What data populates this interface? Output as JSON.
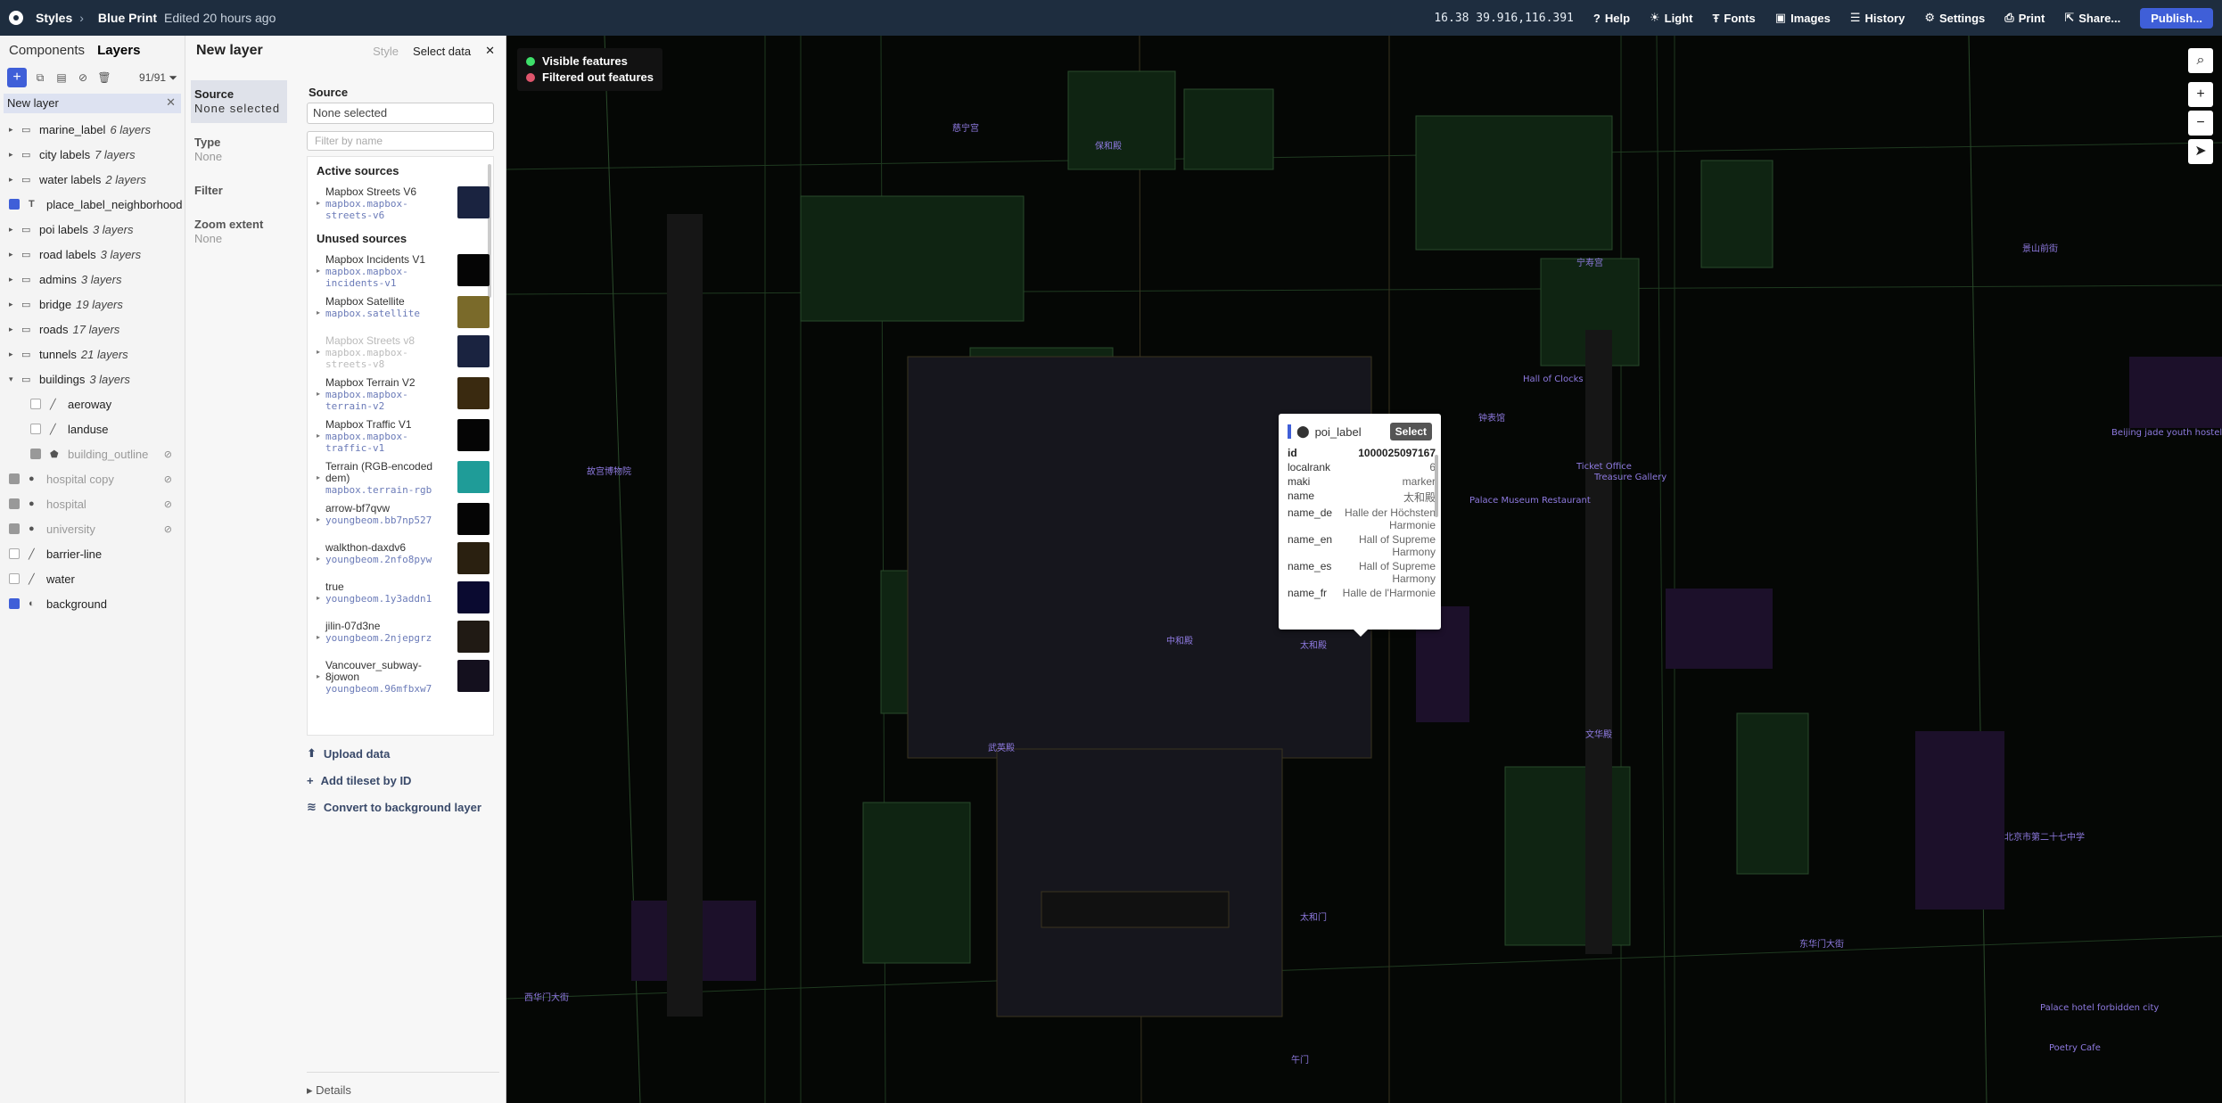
{
  "topbar": {
    "app": "Styles",
    "project": "Blue Print",
    "edited": "Edited 20 hours ago",
    "coords": "16.38 39.916,116.391",
    "buttons": [
      "Help",
      "Light",
      "Fonts",
      "Images",
      "History",
      "Settings",
      "Print",
      "Share..."
    ],
    "publish": "Publish..."
  },
  "left": {
    "tabs": [
      "Components",
      "Layers"
    ],
    "count": "91/91",
    "search_value": "New layer",
    "layers": [
      {
        "name": "marine_label",
        "sub": "6 layers",
        "type": "group"
      },
      {
        "name": "city labels",
        "sub": "7 layers",
        "type": "group"
      },
      {
        "name": "water labels",
        "sub": "2 layers",
        "type": "group"
      },
      {
        "name": "place_label_neighborhood",
        "sub": "",
        "type": "symbol"
      },
      {
        "name": "poi labels",
        "sub": "3 layers",
        "type": "group"
      },
      {
        "name": "road labels",
        "sub": "3 layers",
        "type": "group"
      },
      {
        "name": "admins",
        "sub": "3 layers",
        "type": "group"
      },
      {
        "name": "bridge",
        "sub": "19 layers",
        "type": "group"
      },
      {
        "name": "roads",
        "sub": "17 layers",
        "type": "group"
      },
      {
        "name": "tunnels",
        "sub": "21 layers",
        "type": "group"
      },
      {
        "name": "buildings",
        "sub": "3 layers",
        "type": "group-open"
      },
      {
        "name": "aeroway",
        "sub": "",
        "type": "child"
      },
      {
        "name": "landuse",
        "sub": "",
        "type": "child"
      },
      {
        "name": "building_outline",
        "sub": "",
        "type": "child-dim"
      },
      {
        "name": "hospital copy",
        "sub": "",
        "type": "dim"
      },
      {
        "name": "hospital",
        "sub": "",
        "type": "dim"
      },
      {
        "name": "university",
        "sub": "",
        "type": "dim"
      },
      {
        "name": "barrier-line",
        "sub": "",
        "type": "line"
      },
      {
        "name": "water",
        "sub": "",
        "type": "line"
      },
      {
        "name": "background",
        "sub": "",
        "type": "bg"
      }
    ]
  },
  "mid": {
    "title": "New layer",
    "tab_style": "Style",
    "tab_select": "Select data",
    "nav": [
      {
        "label": "Source",
        "value": "None selected"
      },
      {
        "label": "Type",
        "value": "None"
      },
      {
        "label": "Filter",
        "value": ""
      },
      {
        "label": "Zoom extent",
        "value": "None"
      }
    ],
    "source_heading": "Source",
    "source_value": "None selected",
    "filter_placeholder": "Filter by name",
    "active_heading": "Active sources",
    "unused_heading": "Unused sources",
    "active_sources": [
      {
        "name": "Mapbox Streets V6",
        "id": "mapbox.mapbox-streets-v6",
        "thumb": "#1a2340"
      }
    ],
    "unused_sources": [
      {
        "name": "Mapbox Incidents V1",
        "id": "mapbox.mapbox-incidents-v1",
        "thumb": "#050505"
      },
      {
        "name": "Mapbox Satellite",
        "id": "mapbox.satellite",
        "thumb": "#7a6a2a"
      },
      {
        "name": "Mapbox Streets v8",
        "id": "mapbox.mapbox-streets-v8",
        "thumb": "#1a2340",
        "faded": true
      },
      {
        "name": "Mapbox Terrain V2",
        "id": "mapbox.mapbox-terrain-v2",
        "thumb": "#3a2a10"
      },
      {
        "name": "Mapbox Traffic V1",
        "id": "mapbox.mapbox-traffic-v1",
        "thumb": "#050505"
      },
      {
        "name": "Terrain (RGB-encoded dem)",
        "id": "mapbox.terrain-rgb",
        "thumb": "#1f9c98"
      },
      {
        "name": "arrow-bf7qvw",
        "id": "youngbeom.bb7np527",
        "thumb": "#050505"
      },
      {
        "name": "walkthon-daxdv6",
        "id": "youngbeom.2nfo8pyw",
        "thumb": "#2a2010"
      },
      {
        "name": "true",
        "id": "youngbeom.1y3addn1",
        "thumb": "#0a0a30"
      },
      {
        "name": "jilin-07d3ne",
        "id": "youngbeom.2njepgrz",
        "thumb": "#201a14"
      },
      {
        "name": "Vancouver_subway-8jowon",
        "id": "youngbeom.96mfbxw7",
        "thumb": "#14101e"
      }
    ],
    "actions": [
      "Upload data",
      "Add tileset by ID",
      "Convert to background layer"
    ],
    "details": "Details"
  },
  "map": {
    "legend": [
      "Visible features",
      "Filtered out features"
    ],
    "legend_colors": [
      "#3ee06a",
      "#e0556c"
    ],
    "popup": {
      "layer": "poi_label",
      "select": "Select",
      "rows": [
        [
          "id",
          "1000025097167"
        ],
        [
          "localrank",
          "6"
        ],
        [
          "maki",
          "marker"
        ],
        [
          "name",
          "太和殿"
        ],
        [
          "name_de",
          "Halle der Höchsten Harmonie"
        ],
        [
          "name_en",
          "Hall of Supreme Harmony"
        ],
        [
          "name_es",
          "Hall of Supreme Harmony"
        ],
        [
          "name_fr",
          "Halle de l'Harmonie"
        ]
      ]
    },
    "labels": [
      "西华门大街",
      "东华门大街",
      "故宫博物院",
      "太和殿",
      "太和门",
      "午门",
      "Palace Museum Restaurant",
      "Hall of Clocks",
      "Ticket Office",
      "Treasure Gallery",
      "Beijing jade youth hostel",
      "Palace hotel forbidden city",
      "Poetry Cafe",
      "北京市第二十七中学",
      "景山前街",
      "钟表馆",
      "宁寿宫",
      "保和殿",
      "中和殿",
      "文华殿",
      "武英殿",
      "慈宁宫"
    ]
  }
}
